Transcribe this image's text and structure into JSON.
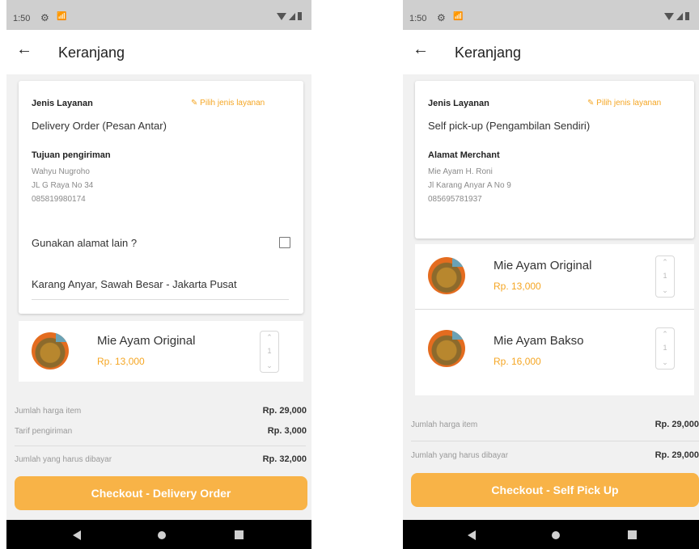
{
  "left": {
    "status": {
      "time": "1:50"
    },
    "header": {
      "back": "←",
      "title": "Keranjang"
    },
    "service": {
      "label": "Jenis Layanan",
      "change_link": "Pilih jenis layanan",
      "value": "Delivery Order (Pesan Antar)"
    },
    "address": {
      "label": "Tujuan pengiriman",
      "lines": [
        "Wahyu Nugroho",
        "JL G Raya No 34",
        "085819980174"
      ]
    },
    "alt_address": {
      "question": "Gunakan alamat lain ?",
      "value": "Karang Anyar, Sawah Besar - Jakarta Pusat"
    },
    "items": [
      {
        "name": "Mie Ayam Original",
        "price": "Rp. 13,000",
        "qty": "1"
      }
    ],
    "summary": {
      "items_label": "Jumlah harga item",
      "items_value": "Rp. 29,000",
      "shipping_label": "Tarif pengiriman",
      "shipping_value": "Rp. 3,000",
      "total_label": "Jumlah yang harus dibayar",
      "total_value": "Rp. 32,000"
    },
    "checkout_label": "Checkout - Delivery Order"
  },
  "right": {
    "status": {
      "time": "1:50"
    },
    "header": {
      "back": "←",
      "title": "Keranjang"
    },
    "service": {
      "label": "Jenis Layanan",
      "change_link": "Pilih jenis layanan",
      "value": "Self pick-up (Pengambilan Sendiri)"
    },
    "address": {
      "label": "Alamat Merchant",
      "lines": [
        "Mie Ayam H. Roni",
        "Jl Karang Anyar A No 9",
        "085695781937"
      ]
    },
    "items": [
      {
        "name": "Mie Ayam Original",
        "price": "Rp. 13,000",
        "qty": "1"
      },
      {
        "name": "Mie Ayam Bakso",
        "price": "Rp. 16,000",
        "qty": "1"
      }
    ],
    "summary": {
      "items_label": "Jumlah harga item",
      "items_value": "Rp. 29,000",
      "total_label": "Jumlah yang harus dibayar",
      "total_value": "Rp. 29,000"
    },
    "checkout_label": "Checkout - Self Pick Up"
  },
  "icons": {
    "pencil": "✎",
    "chevron_up": "⌃",
    "chevron_down": "⌄"
  },
  "colors": {
    "accent": "#f5a623",
    "button": "#f8b347"
  }
}
